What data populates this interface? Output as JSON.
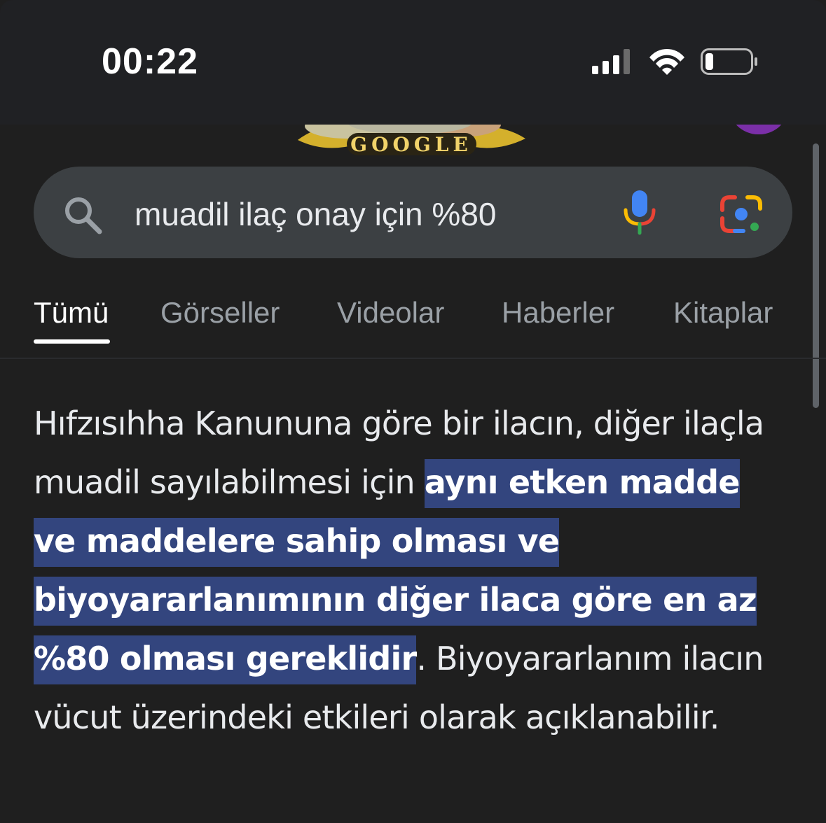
{
  "status_bar": {
    "time": "00:22",
    "icons": [
      "cellular-signal-icon",
      "wifi-icon",
      "battery-icon"
    ]
  },
  "doodle": {
    "text": "GOOGLE"
  },
  "search": {
    "query": "muadil ilaç onay için %80",
    "icons": [
      "search-icon",
      "microphone-icon",
      "google-lens-icon"
    ]
  },
  "tabs": [
    {
      "label": "Tümü",
      "active": true
    },
    {
      "label": "Görseller",
      "active": false
    },
    {
      "label": "Videolar",
      "active": false
    },
    {
      "label": "Haberler",
      "active": false
    },
    {
      "label": "Kitaplar",
      "active": false
    }
  ],
  "result": {
    "before": "Hıfzısıhha Kanununa göre bir ilacın, diğer ilaçla muadil sayılabilmesi için ",
    "highlight": "aynı etken madde ve maddelere sahip olması ve biyoyararlanımının diğer ilaca göre en az %80 olması gereklidir",
    "after": ". Biyoyararlanım ilacın vücut üzerindeki etkileri olarak açıklanabilir."
  },
  "colors": {
    "background": "#1f1f1f",
    "search_box": "#3c4043",
    "highlight": "#33457e",
    "tab_inactive": "#9aa0a6"
  }
}
